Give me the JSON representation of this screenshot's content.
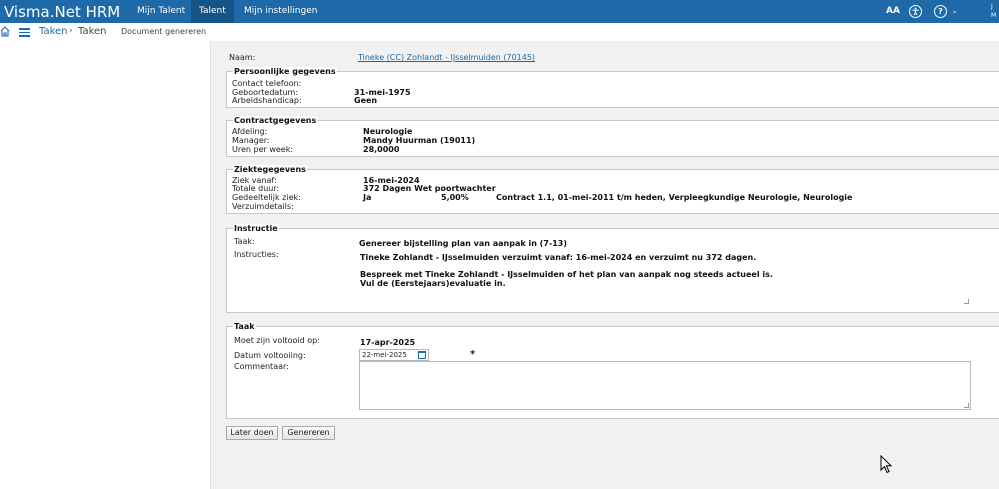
{
  "app": {
    "brand": "Visma.Net HRM",
    "nav": [
      "Mijn Talent",
      "Talent",
      "Mijn instellingen"
    ],
    "active_nav": "Talent",
    "icons": {
      "text_size": "AA",
      "accessibility": "accessibility-icon",
      "help": "?"
    },
    "user_initials": [
      "J",
      "M"
    ]
  },
  "breadcrumb": {
    "menu": "Taken",
    "separator": "›",
    "current": "Taken",
    "page": "Document genereren"
  },
  "form": {
    "naam_label": "Naam:",
    "naam_value": "Tineke (CC) Zohlandt - IJsselmuiden (70145)",
    "persoonlijk": {
      "legend": "Persoonlijke gegevens",
      "telefoon_label": "Contact telefoon:",
      "telefoon_value": "",
      "geboortedatum_label": "Geboortedatum:",
      "geboortedatum_value": "31-mei-1975",
      "handicap_label": "Arbeidshandicap:",
      "handicap_value": "Geen"
    },
    "contract": {
      "legend": "Contractgegevens",
      "afdeling_label": "Afdeling:",
      "afdeling_value": "Neurologie",
      "manager_label": "Manager:",
      "manager_value": "Mandy Huurman (19011)",
      "uren_label": "Uren per week:",
      "uren_value": "28,0000"
    },
    "ziekte": {
      "legend": "Ziektegegevens",
      "vanaf_label": "Ziek vanaf:",
      "vanaf_value": "16-mei-2024",
      "duur_label": "Totale duur:",
      "duur_value": "372 Dagen Wet poortwachter",
      "gedeeltelijk_label": "Gedeeltelijk ziek:",
      "gedeeltelijk_value": "Ja",
      "percentage": "5,00%",
      "contract_info": "Contract 1.1, 01-mei-2011 t/m heden, Verpleegkundige Neurologie, Neurologie",
      "verzuim_label": "Verzuimdetails:"
    },
    "instructie": {
      "legend": "Instructie",
      "taak_label": "Taak:",
      "taak_value": "Genereer bijstelling plan van aanpak in (7-13)",
      "instructies_label": "Instructies:",
      "line1": "Tineke Zohlandt - IJsselmuiden verzuimt vanaf:  16-mei-2024 en verzuimt nu 372 dagen.",
      "line2": "Bespreek met Tineke Zohlandt - IJsselmuiden of het plan van aanpak nog steeds actueel is.",
      "line3": "Vul de (Eerstejaars)evaluatie in."
    },
    "taak": {
      "legend": "Taak",
      "voltooid_op_label": "Moet zijn voltooid op:",
      "voltooid_op_value": "17-apr-2025",
      "datum_label": "Datum voltooiing:",
      "datum_value": "22-mei-2025",
      "required_mark": "*",
      "commentaar_label": "Commentaar:",
      "commentaar_value": ""
    },
    "buttons": {
      "later": "Later doen",
      "genereren": "Genereren"
    }
  },
  "colors": {
    "topbar": "#1e6aa8",
    "active_tab": "#155486",
    "link": "#1e6aa8",
    "content_bg": "#f1f1f1"
  }
}
